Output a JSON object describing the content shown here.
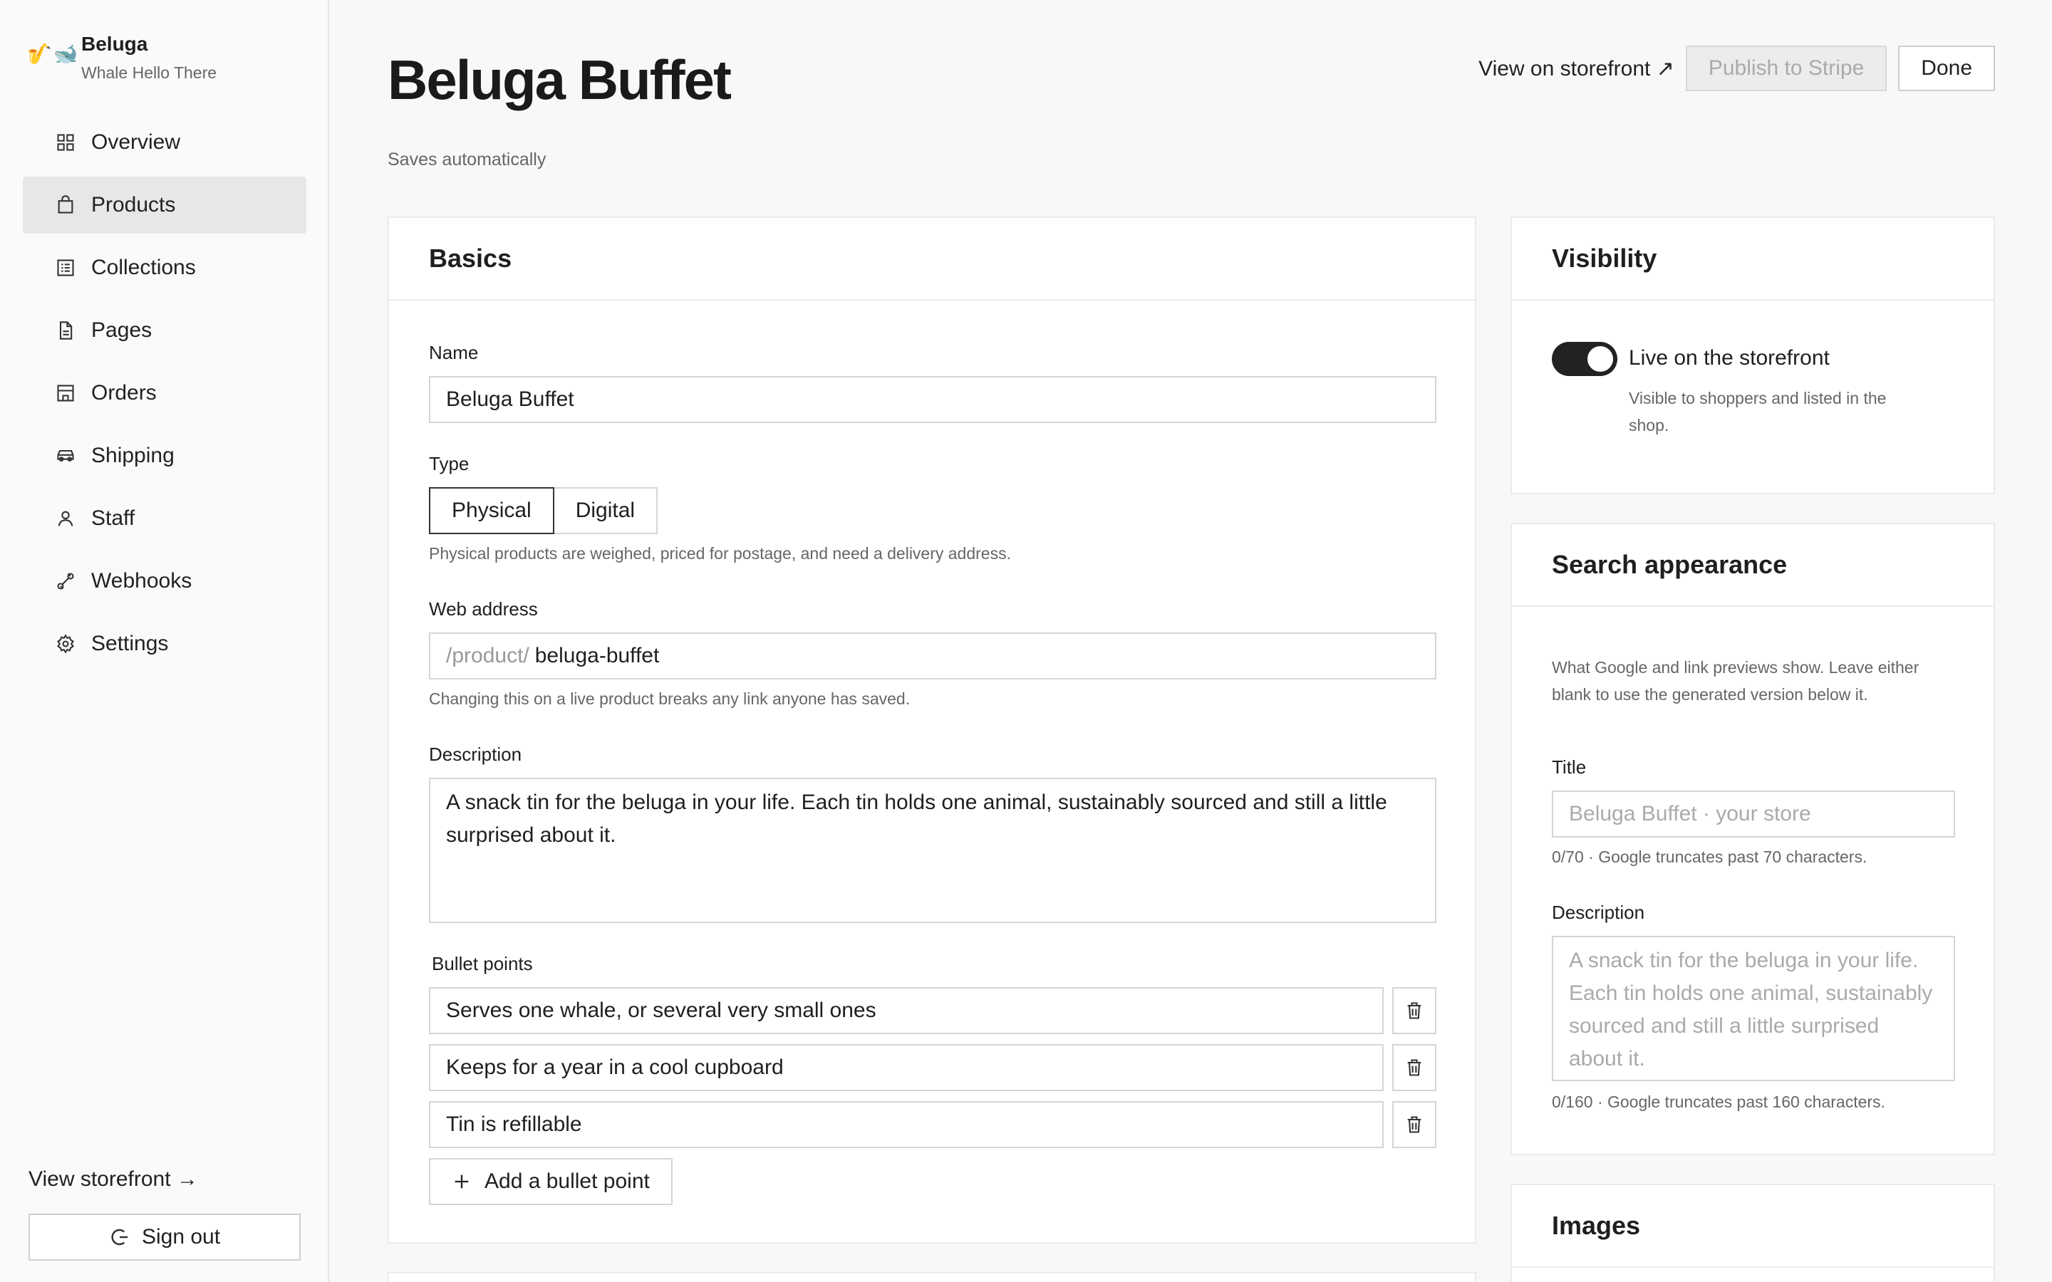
{
  "brand": {
    "logo": "🎷🐋",
    "name": "Beluga",
    "tagline": "Whale Hello There"
  },
  "sidebar": {
    "items": [
      {
        "label": "Overview",
        "icon": "grid-icon"
      },
      {
        "label": "Products",
        "icon": "bag-icon",
        "active": true
      },
      {
        "label": "Collections",
        "icon": "list-icon"
      },
      {
        "label": "Pages",
        "icon": "page-icon"
      },
      {
        "label": "Orders",
        "icon": "store-icon"
      },
      {
        "label": "Shipping",
        "icon": "car-icon"
      },
      {
        "label": "Staff",
        "icon": "user-icon"
      },
      {
        "label": "Webhooks",
        "icon": "webhook-icon"
      },
      {
        "label": "Settings",
        "icon": "gear-icon"
      }
    ],
    "view_storefront": "View storefront →",
    "sign_out": "Sign out"
  },
  "header": {
    "title": "Beluga Buffet",
    "subtitle": "Saves automatically",
    "view_link": "View on storefront ↗",
    "publish": "Publish to Stripe",
    "done": "Done"
  },
  "basics": {
    "heading": "Basics",
    "name_label": "Name",
    "name_value": "Beluga Buffet",
    "type_label": "Type",
    "type_options": [
      "Physical",
      "Digital"
    ],
    "type_selected": "Physical",
    "type_help": "Physical products are weighed, priced for postage, and need a delivery address.",
    "web_label": "Web address",
    "web_prefix": "/product/",
    "web_value": "beluga-buffet",
    "web_help": "Changing this on a live product breaks any link anyone has saved.",
    "desc_label": "Description",
    "desc_value": "A snack tin for the beluga in your life. Each tin holds one animal, sustainably sourced and still a little surprised about it.",
    "bullets_label": "Bullet points",
    "bullets": [
      "Serves one whale, or several very small ones",
      "Keeps for a year in a cool cupboard",
      "Tin is refillable"
    ],
    "add_bullet": "Add a bullet point"
  },
  "visibility": {
    "heading": "Visibility",
    "toggle_label": "Live on the storefront",
    "toggle_on": true,
    "help": "Visible to shoppers and listed in the shop."
  },
  "search": {
    "heading": "Search appearance",
    "intro": "What Google and link previews show. Leave either blank to use the generated version below it.",
    "title_label": "Title",
    "title_placeholder": "Beluga Buffet · your store",
    "title_count": "0/70 · Google truncates past 70 characters.",
    "desc_label": "Description",
    "desc_placeholder": "A snack tin for the beluga in your life. Each tin holds one animal, sustainably sourced and still a little surprised about it.",
    "desc_count": "0/160 · Google truncates past 160 characters."
  },
  "images": {
    "heading": "Images"
  }
}
